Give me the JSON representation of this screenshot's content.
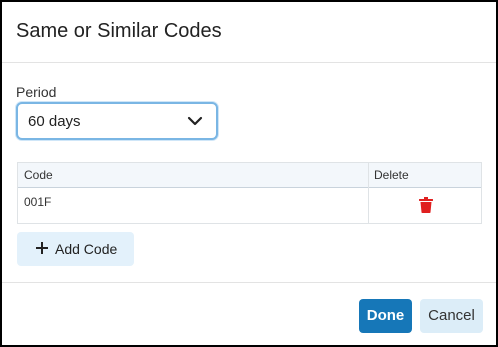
{
  "dialog": {
    "title": "Same or Similar Codes"
  },
  "period": {
    "label": "Period",
    "selected": "60 days",
    "icon": "chevron-down-icon"
  },
  "table": {
    "columns": [
      "Code",
      "Delete"
    ],
    "rows": [
      {
        "code": "001F",
        "delete_icon": "trash-icon"
      }
    ]
  },
  "add_button": {
    "label": "Add Code",
    "icon": "plus-icon"
  },
  "footer": {
    "done_label": "Done",
    "cancel_label": "Cancel"
  },
  "colors": {
    "primary": "#1677b8",
    "secondary_button": "#dcedf8",
    "delete_icon": "#e02020",
    "focus_border": "#7ab6e4"
  }
}
